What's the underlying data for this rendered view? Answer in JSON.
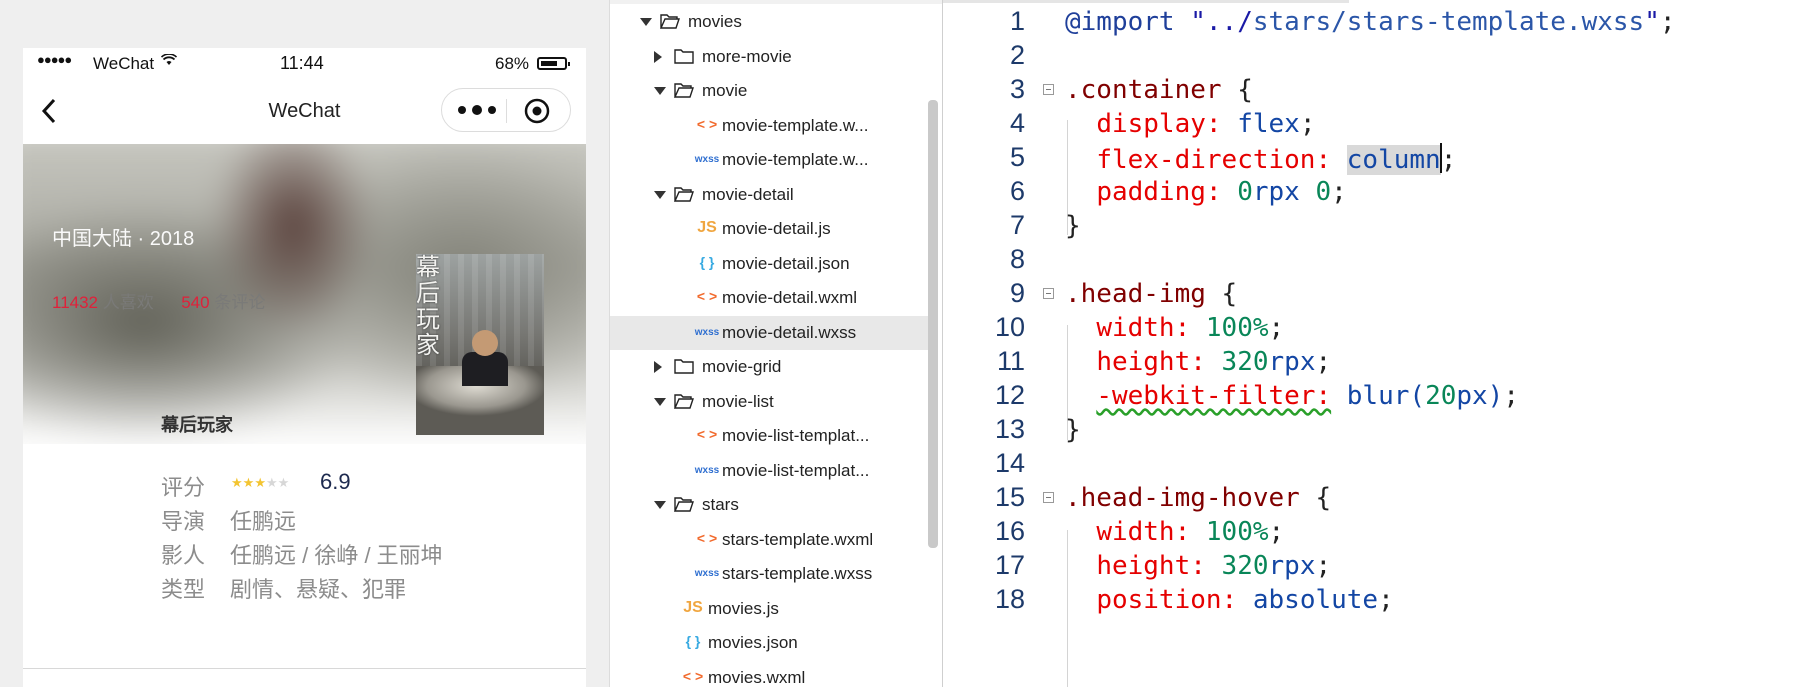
{
  "simulator": {
    "status_bar": {
      "signal": "●●●●●",
      "carrier": "WeChat",
      "time": "11:44",
      "battery": "68%"
    },
    "nav": {
      "title": "WeChat"
    },
    "movie": {
      "country_year": "中国大陆 · 2018",
      "likes_count": "11432",
      "likes_label": "人喜欢",
      "comments_count": "540",
      "comments_label": "条评论",
      "poster_title": "幕后玩家",
      "name": "幕后玩家",
      "rating_stars": 3,
      "rating_max": 5,
      "info": [
        {
          "label": "评分",
          "value": "6.9"
        },
        {
          "label": "导演",
          "value": "任鹏远"
        },
        {
          "label": "影人",
          "value": "任鹏远 / 徐峥 / 王丽坤"
        },
        {
          "label": "类型",
          "value": "剧情、悬疑、犯罪"
        }
      ]
    }
  },
  "file_tree": [
    {
      "label": "movies",
      "type": "folder",
      "state": "open",
      "depth": 0
    },
    {
      "label": "more-movie",
      "type": "folder",
      "state": "closed",
      "depth": 1
    },
    {
      "label": "movie",
      "type": "folder",
      "state": "open",
      "depth": 1
    },
    {
      "label": "movie-template.w...",
      "type": "wxml",
      "depth": 2
    },
    {
      "label": "movie-template.w...",
      "type": "wxss",
      "depth": 2
    },
    {
      "label": "movie-detail",
      "type": "folder",
      "state": "open",
      "depth": 1
    },
    {
      "label": "movie-detail.js",
      "type": "js",
      "depth": 2
    },
    {
      "label": "movie-detail.json",
      "type": "json",
      "depth": 2
    },
    {
      "label": "movie-detail.wxml",
      "type": "wxml",
      "depth": 2
    },
    {
      "label": "movie-detail.wxss",
      "type": "wxss",
      "depth": 2,
      "selected": true
    },
    {
      "label": "movie-grid",
      "type": "folder",
      "state": "closed",
      "depth": 1
    },
    {
      "label": "movie-list",
      "type": "folder",
      "state": "open",
      "depth": 1
    },
    {
      "label": "movie-list-templat...",
      "type": "wxml",
      "depth": 2
    },
    {
      "label": "movie-list-templat...",
      "type": "wxss",
      "depth": 2
    },
    {
      "label": "stars",
      "type": "folder",
      "state": "open",
      "depth": 1
    },
    {
      "label": "stars-template.wxml",
      "type": "wxml",
      "depth": 2
    },
    {
      "label": "stars-template.wxss",
      "type": "wxss",
      "depth": 2
    },
    {
      "label": "movies.js",
      "type": "js",
      "depth": 1
    },
    {
      "label": "movies.json",
      "type": "json",
      "depth": 1
    },
    {
      "label": "movies.wxml",
      "type": "wxml",
      "depth": 1
    }
  ],
  "file_icons": {
    "wxml": "< >",
    "wxss": "wxss",
    "js": "JS",
    "json": "{ }"
  },
  "editor": {
    "lines": [
      {
        "n": "1",
        "tokens": [
          [
            "at",
            "@import"
          ],
          [
            "pun",
            " "
          ],
          [
            "str",
            "\"../"
          ],
          [
            "str2",
            "stars/stars-template.wxss"
          ],
          [
            "str",
            "\""
          ],
          [
            "pun",
            ";"
          ]
        ]
      },
      {
        "n": "2",
        "tokens": []
      },
      {
        "n": "3",
        "fold": true,
        "tokens": [
          [
            "sel",
            ".container"
          ],
          [
            "pun",
            " {"
          ]
        ]
      },
      {
        "n": "4",
        "tokens": [
          [
            "pun",
            "  "
          ],
          [
            "prop",
            "display:"
          ],
          [
            "pun",
            " "
          ],
          [
            "val",
            "flex"
          ],
          [
            "pun",
            ";"
          ]
        ]
      },
      {
        "n": "5",
        "tokens": [
          [
            "pun",
            "  "
          ],
          [
            "prop",
            "flex-direction:"
          ],
          [
            "pun",
            " "
          ],
          [
            "valhl",
            "column"
          ],
          [
            "cursor",
            ""
          ],
          [
            "pun",
            ";"
          ]
        ]
      },
      {
        "n": "6",
        "tokens": [
          [
            "pun",
            "  "
          ],
          [
            "prop",
            "padding:"
          ],
          [
            "pun",
            " "
          ],
          [
            "num",
            "0"
          ],
          [
            "val",
            "rpx"
          ],
          [
            "pun",
            " "
          ],
          [
            "num",
            "0"
          ],
          [
            "pun",
            ";"
          ]
        ]
      },
      {
        "n": "7",
        "tokens": [
          [
            "pun",
            "}"
          ]
        ]
      },
      {
        "n": "8",
        "tokens": []
      },
      {
        "n": "9",
        "fold": true,
        "tokens": [
          [
            "sel",
            ".head-img"
          ],
          [
            "pun",
            " {"
          ]
        ]
      },
      {
        "n": "10",
        "tokens": [
          [
            "pun",
            "  "
          ],
          [
            "prop",
            "width:"
          ],
          [
            "pun",
            " "
          ],
          [
            "num",
            "100%"
          ],
          [
            "pun",
            ";"
          ]
        ]
      },
      {
        "n": "11",
        "tokens": [
          [
            "pun",
            "  "
          ],
          [
            "prop",
            "height:"
          ],
          [
            "pun",
            " "
          ],
          [
            "num",
            "320"
          ],
          [
            "val",
            "rpx"
          ],
          [
            "pun",
            ";"
          ]
        ]
      },
      {
        "n": "12",
        "tokens": [
          [
            "pun",
            "  "
          ],
          [
            "propwarn",
            "-webkit-filter:"
          ],
          [
            "pun",
            " "
          ],
          [
            "val",
            "blur("
          ],
          [
            "num",
            "20"
          ],
          [
            "val",
            "px)"
          ],
          [
            "pun",
            ";"
          ]
        ]
      },
      {
        "n": "13",
        "tokens": [
          [
            "pun",
            "}"
          ]
        ]
      },
      {
        "n": "14",
        "tokens": []
      },
      {
        "n": "15",
        "fold": true,
        "tokens": [
          [
            "sel",
            ".head-img-hover"
          ],
          [
            "pun",
            " {"
          ]
        ]
      },
      {
        "n": "16",
        "tokens": [
          [
            "pun",
            "  "
          ],
          [
            "prop",
            "width:"
          ],
          [
            "pun",
            " "
          ],
          [
            "num",
            "100%"
          ],
          [
            "pun",
            ";"
          ]
        ]
      },
      {
        "n": "17",
        "tokens": [
          [
            "pun",
            "  "
          ],
          [
            "prop",
            "height:"
          ],
          [
            "pun",
            " "
          ],
          [
            "num",
            "320"
          ],
          [
            "val",
            "rpx"
          ],
          [
            "pun",
            ";"
          ]
        ]
      },
      {
        "n": "18",
        "tokens": [
          [
            "pun",
            "  "
          ],
          [
            "prop",
            "position:"
          ],
          [
            "pun",
            " "
          ],
          [
            "val",
            "absolute"
          ],
          [
            "pun",
            ";"
          ]
        ]
      }
    ]
  }
}
